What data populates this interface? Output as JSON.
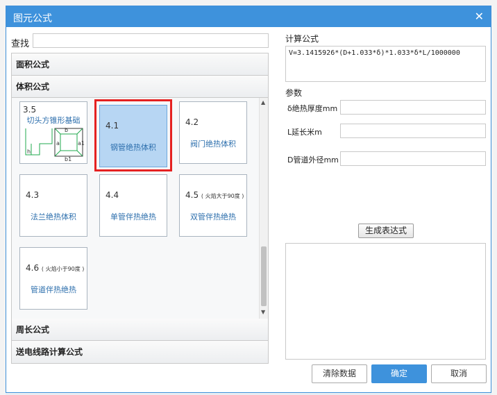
{
  "dialog": {
    "title": "图元公式",
    "close_label": "✕"
  },
  "search": {
    "label": "查找",
    "value": ""
  },
  "categories": {
    "area": "面积公式",
    "volume": "体积公式",
    "perimeter": "周长公式",
    "transmission": "送电线路计算公式"
  },
  "tiles": [
    {
      "num": "3.5",
      "note": "",
      "name": "切头方锥形基础",
      "diagram_labels": [
        "b",
        "a",
        "a1",
        "h",
        "b1"
      ]
    },
    {
      "num": "4.1",
      "note": "",
      "name": "钢管绝热体积"
    },
    {
      "num": "4.2",
      "note": "",
      "name": "阀门绝热体积"
    },
    {
      "num": "4.3",
      "note": "",
      "name": "法兰绝热体积"
    },
    {
      "num": "4.4",
      "note": "",
      "name": "单管伴热绝热"
    },
    {
      "num": "4.5",
      "note": "( 火焰大于90度 )",
      "name": "双管伴热绝热"
    },
    {
      "num": "4.6",
      "note": "( 火焰小于90度 )",
      "name": "管道伴热绝热"
    }
  ],
  "selected_tile": "4.1",
  "formula": {
    "label": "计算公式",
    "value": "V=3.1415926*(D+1.033*δ)*1.033*δ*L/1000000"
  },
  "params": {
    "label": "参数",
    "items": [
      {
        "label": "δ绝热厚度mm",
        "value": ""
      },
      {
        "label": "L延长米m",
        "value": ""
      },
      {
        "label": "D管道外径mm",
        "value": ""
      }
    ]
  },
  "buttons": {
    "generate": "生成表达式",
    "clear": "清除数据",
    "ok": "确定",
    "cancel": "取消"
  },
  "colors": {
    "accent": "#3e92dc",
    "highlight": "#e52121",
    "selected_tile": "#b7d6f3"
  }
}
